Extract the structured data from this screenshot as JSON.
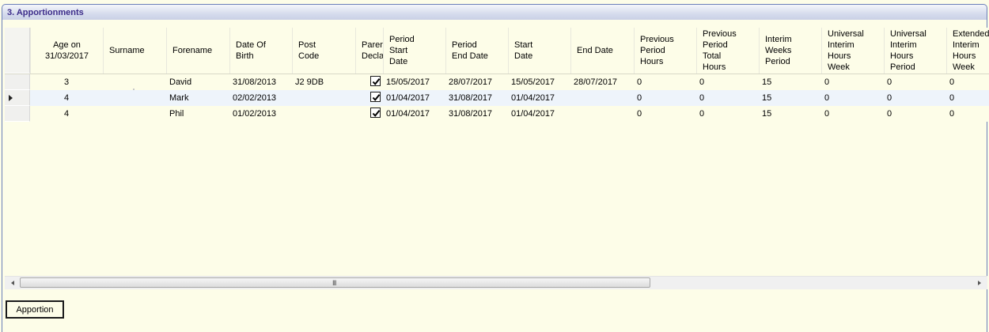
{
  "panel": {
    "title": "3. Apportionments"
  },
  "grid": {
    "columns": [
      {
        "key": "age",
        "label": "Age on\n31/03/2017"
      },
      {
        "key": "surname",
        "label": "Surname"
      },
      {
        "key": "forename",
        "label": "Forename"
      },
      {
        "key": "dob",
        "label": "Date Of\nBirth"
      },
      {
        "key": "postcode",
        "label": "Post\nCode"
      },
      {
        "key": "parent_decl",
        "label": "Parent\nDeclaration"
      },
      {
        "key": "period_start",
        "label": "Period\nStart\nDate"
      },
      {
        "key": "period_end",
        "label": "Period\nEnd Date"
      },
      {
        "key": "start_date",
        "label": "Start\nDate"
      },
      {
        "key": "end_date",
        "label": "End Date"
      },
      {
        "key": "prev_hours",
        "label": "Previous\nPeriod\nHours"
      },
      {
        "key": "prev_total",
        "label": "Previous\nPeriod\nTotal\nHours"
      },
      {
        "key": "interim_weeks",
        "label": "Interim\nWeeks\nPeriod"
      },
      {
        "key": "uni_week",
        "label": "Universal\nInterim\nHours\nWeek"
      },
      {
        "key": "uni_period",
        "label": "Universal\nInterim\nHours\nPeriod"
      },
      {
        "key": "ext_week",
        "label": "Extended\nInterim\nHours\nWeek"
      }
    ],
    "rows": [
      {
        "age": "3",
        "surname": "",
        "forename": "David",
        "dob": "31/08/2013",
        "postcode": "J2 9DB",
        "parent_decl": true,
        "period_start": "15/05/2017",
        "period_end": "28/07/2017",
        "start_date": "15/05/2017",
        "end_date": "28/07/2017",
        "prev_hours": "0",
        "prev_total": "0",
        "interim_weeks": "15",
        "uni_week": "0",
        "uni_period": "0",
        "ext_week": "0"
      },
      {
        "age": "4",
        "surname": "",
        "forename": "Mark",
        "dob": "02/02/2013",
        "postcode": "",
        "parent_decl": true,
        "period_start": "01/04/2017",
        "period_end": "31/08/2017",
        "start_date": "01/04/2017",
        "end_date": "",
        "prev_hours": "0",
        "prev_total": "0",
        "interim_weeks": "15",
        "uni_week": "0",
        "uni_period": "0",
        "ext_week": "0"
      },
      {
        "age": "4",
        "surname": "",
        "forename": "Phil",
        "dob": "01/02/2013",
        "postcode": "",
        "parent_decl": true,
        "period_start": "01/04/2017",
        "period_end": "31/08/2017",
        "start_date": "01/04/2017",
        "end_date": "",
        "prev_hours": "0",
        "prev_total": "0",
        "interim_weeks": "15",
        "uni_week": "0",
        "uni_period": "0",
        "ext_week": "0"
      }
    ],
    "current_row": 1
  },
  "scrollbar": {
    "grip": "III"
  },
  "actions": {
    "apportion_label": "Apportion"
  }
}
